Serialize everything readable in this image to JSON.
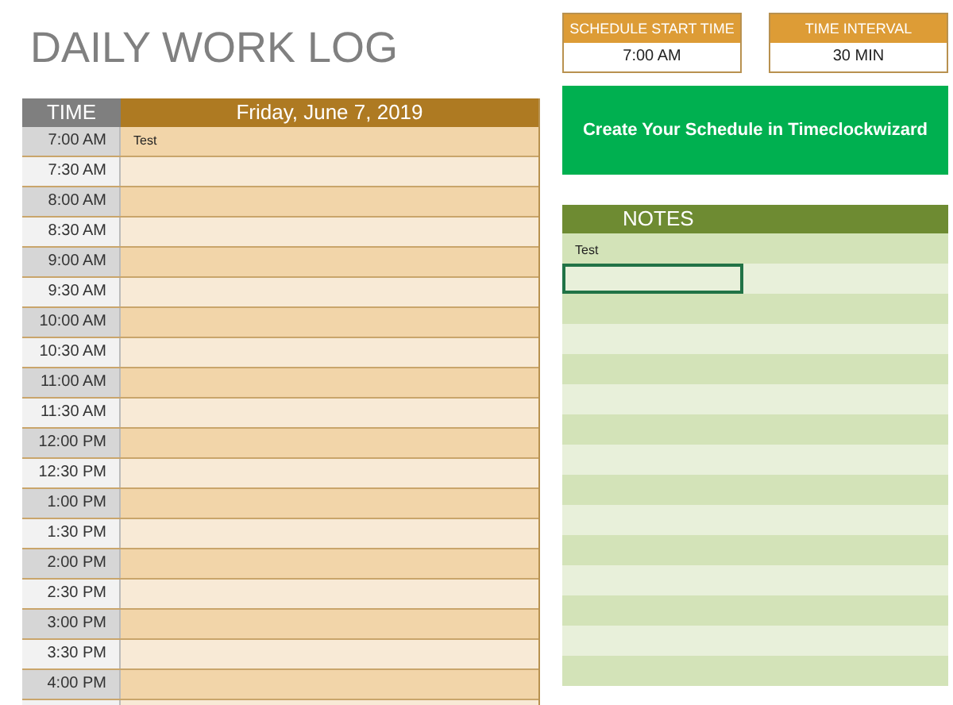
{
  "title": "DAILY WORK LOG",
  "settings": [
    {
      "label": "SCHEDULE START TIME",
      "value": "7:00 AM"
    },
    {
      "label": "TIME INTERVAL",
      "value": "30 MIN"
    }
  ],
  "schedule": {
    "time_header": "TIME",
    "date_header": "Friday, June 7, 2019",
    "rows": [
      {
        "time": "7:00 AM",
        "entry": "Test"
      },
      {
        "time": "7:30 AM"
      },
      {
        "time": "8:00 AM"
      },
      {
        "time": "8:30 AM"
      },
      {
        "time": "9:00 AM"
      },
      {
        "time": "9:30 AM"
      },
      {
        "time": "10:00 AM"
      },
      {
        "time": "10:30 AM"
      },
      {
        "time": "11:00 AM"
      },
      {
        "time": "11:30 AM"
      },
      {
        "time": "12:00 PM"
      },
      {
        "time": "12:30 PM"
      },
      {
        "time": "1:00 PM"
      },
      {
        "time": "1:30 PM"
      },
      {
        "time": "2:00 PM"
      },
      {
        "time": "2:30 PM"
      },
      {
        "time": "3:00 PM"
      },
      {
        "time": "3:30 PM"
      },
      {
        "time": "4:00 PM"
      }
    ]
  },
  "cta_button": "Create Your Schedule in Timeclockwizard",
  "notes": {
    "header": "NOTES",
    "rows": [
      {
        "text": "Test",
        "selected": false
      },
      {
        "selected": true
      },
      {
        "selected": false
      },
      {
        "selected": false
      },
      {
        "selected": false
      },
      {
        "selected": false
      },
      {
        "selected": false
      },
      {
        "selected": false
      },
      {
        "selected": false
      },
      {
        "selected": false
      },
      {
        "selected": false
      },
      {
        "selected": false
      },
      {
        "selected": false
      },
      {
        "selected": false
      },
      {
        "selected": false
      }
    ]
  }
}
